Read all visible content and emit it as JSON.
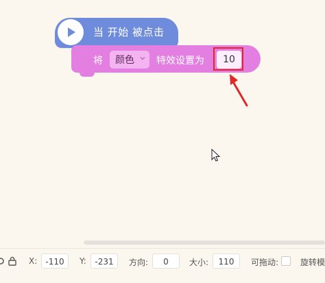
{
  "hat_block": {
    "label": "当 开始 被点击",
    "icon": "play-icon",
    "color": "#6e8bdc"
  },
  "effect_block": {
    "prefix": "将",
    "effect_dropdown": "颜色",
    "middle": "特效设置为",
    "value": "10",
    "color": "#e37fe1"
  },
  "annotation": {
    "color": "#e02828"
  },
  "properties": {
    "x_label": "X:",
    "x_value": "-110",
    "y_label": "Y:",
    "y_value": "-231",
    "direction_label": "方向:",
    "direction_value": "0",
    "size_label": "大小:",
    "size_value": "110",
    "draggable_label": "可拖动:",
    "rotation_label": "旋转模"
  }
}
